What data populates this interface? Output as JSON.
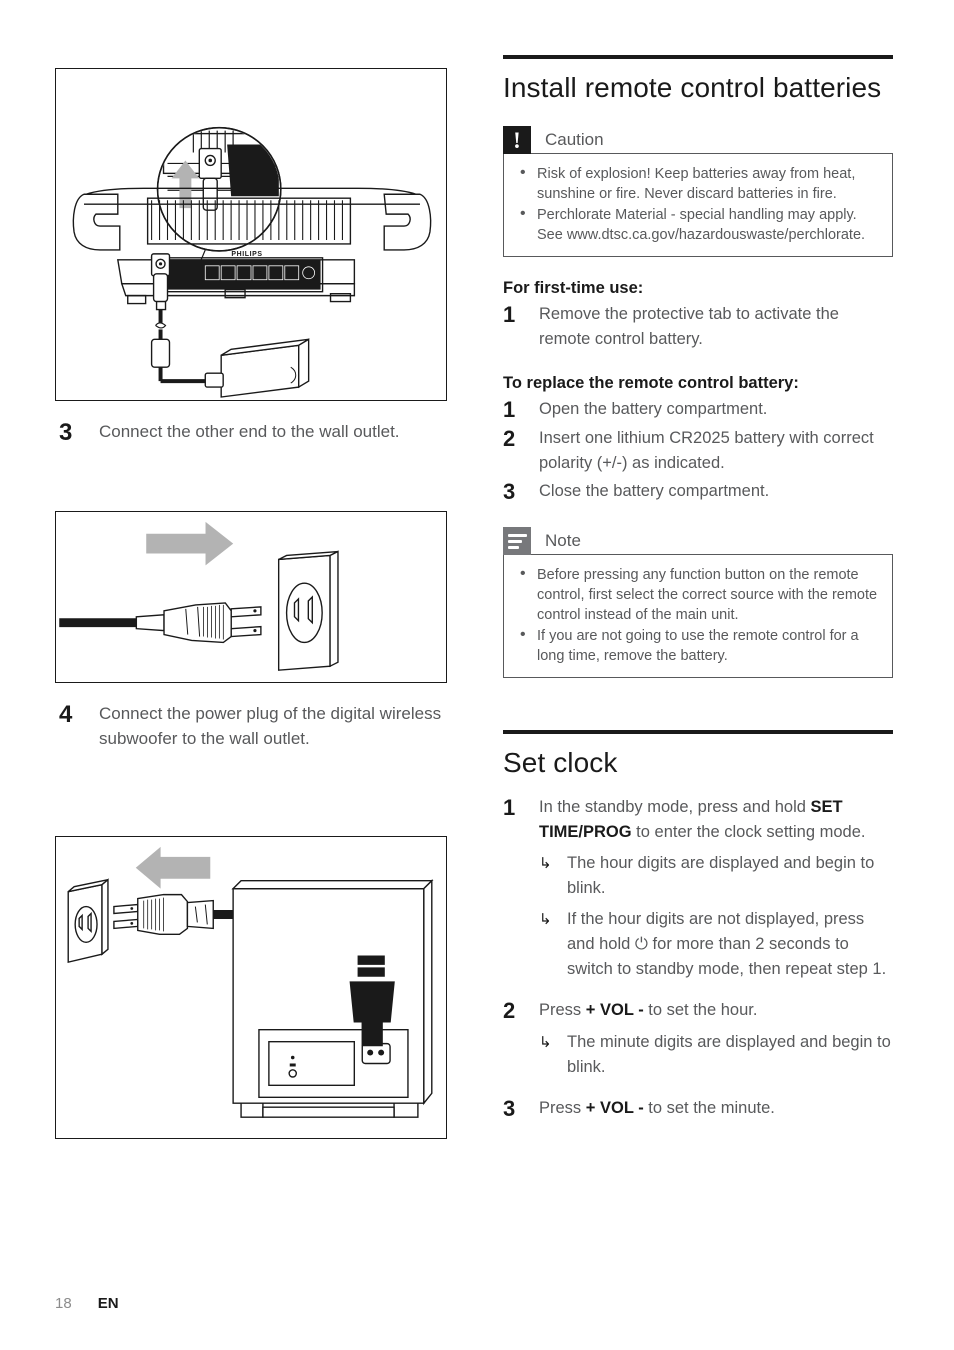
{
  "page": {
    "number": "18",
    "language": "EN"
  },
  "left_column": {
    "figure_1": {
      "caption_alt": "Power adapter plugged into the rear of the main unit",
      "brand_label": "PHILIPS"
    },
    "step_3": {
      "number": "3",
      "text": "Connect the other end to the wall outlet."
    },
    "figure_2": {
      "caption_alt": "Power plug being inserted into a wall outlet, arrow pointing right"
    },
    "step_4": {
      "number": "4",
      "text": "Connect the power plug of the digital wireless subwoofer to the wall outlet."
    },
    "figure_3": {
      "caption_alt": "Digital wireless subwoofer connected by power cord to a wall outlet, arrow pointing left"
    }
  },
  "right_column": {
    "section_batteries": {
      "title": "Install remote control batteries",
      "caution": {
        "label": "Caution",
        "icon": "exclamation-icon",
        "items": [
          "Risk of explosion! Keep batteries away from heat, sunshine or fire. Never discard batteries in fire.",
          "Perchlorate Material - special handling may apply. See www.dtsc.ca.gov/hazardouswaste/perchlorate."
        ]
      },
      "first_time_heading": "For first-time use:",
      "first_time_steps": [
        {
          "number": "1",
          "text": "Remove the protective tab to activate the remote control battery."
        }
      ],
      "replace_heading": "To replace the remote control battery:",
      "replace_steps": [
        {
          "number": "1",
          "text": "Open the battery compartment."
        },
        {
          "number": "2",
          "text": "Insert one lithium CR2025 battery with correct polarity (+/-) as indicated."
        },
        {
          "number": "3",
          "text": "Close the battery compartment."
        }
      ],
      "note": {
        "label": "Note",
        "icon": "note-lines-icon",
        "items": [
          "Before pressing any function button on the remote control, first select the correct source with the remote control instead of the main unit.",
          "If you are not going to use the remote control for a long time, remove the battery."
        ]
      }
    },
    "section_clock": {
      "title": "Set clock",
      "step_1": {
        "number": "1",
        "text_before": "In the standby mode, press and hold ",
        "bold": "SET TIME/PROG",
        "text_after": " to enter the clock setting mode.",
        "results": [
          {
            "glyph": "↳",
            "text": "The hour digits are displayed and begin to blink."
          },
          {
            "glyph": "↳",
            "text_before": "If the hour digits are not displayed, press and hold ",
            "symbol": "⏻",
            "text_after": " for more than 2 seconds to switch to standby mode, then repeat step 1."
          }
        ]
      },
      "step_2": {
        "number": "2",
        "text_before": "Press ",
        "bold": "+ VOL -",
        "text_after": " to set the hour.",
        "results": [
          {
            "glyph": "↳",
            "text": "The minute digits are displayed and begin to blink."
          }
        ]
      },
      "step_3": {
        "number": "3",
        "text_before": "Press ",
        "bold": "+ VOL -",
        "text_after": " to set the minute."
      }
    }
  },
  "colors": {
    "body_text": "#58595b",
    "heading": "#1a1a1a",
    "rule": "#1a1a1a",
    "note_badge": "#77787b",
    "caution_badge": "#1a1a1a",
    "arrow_gray": "#b3b3b3"
  }
}
